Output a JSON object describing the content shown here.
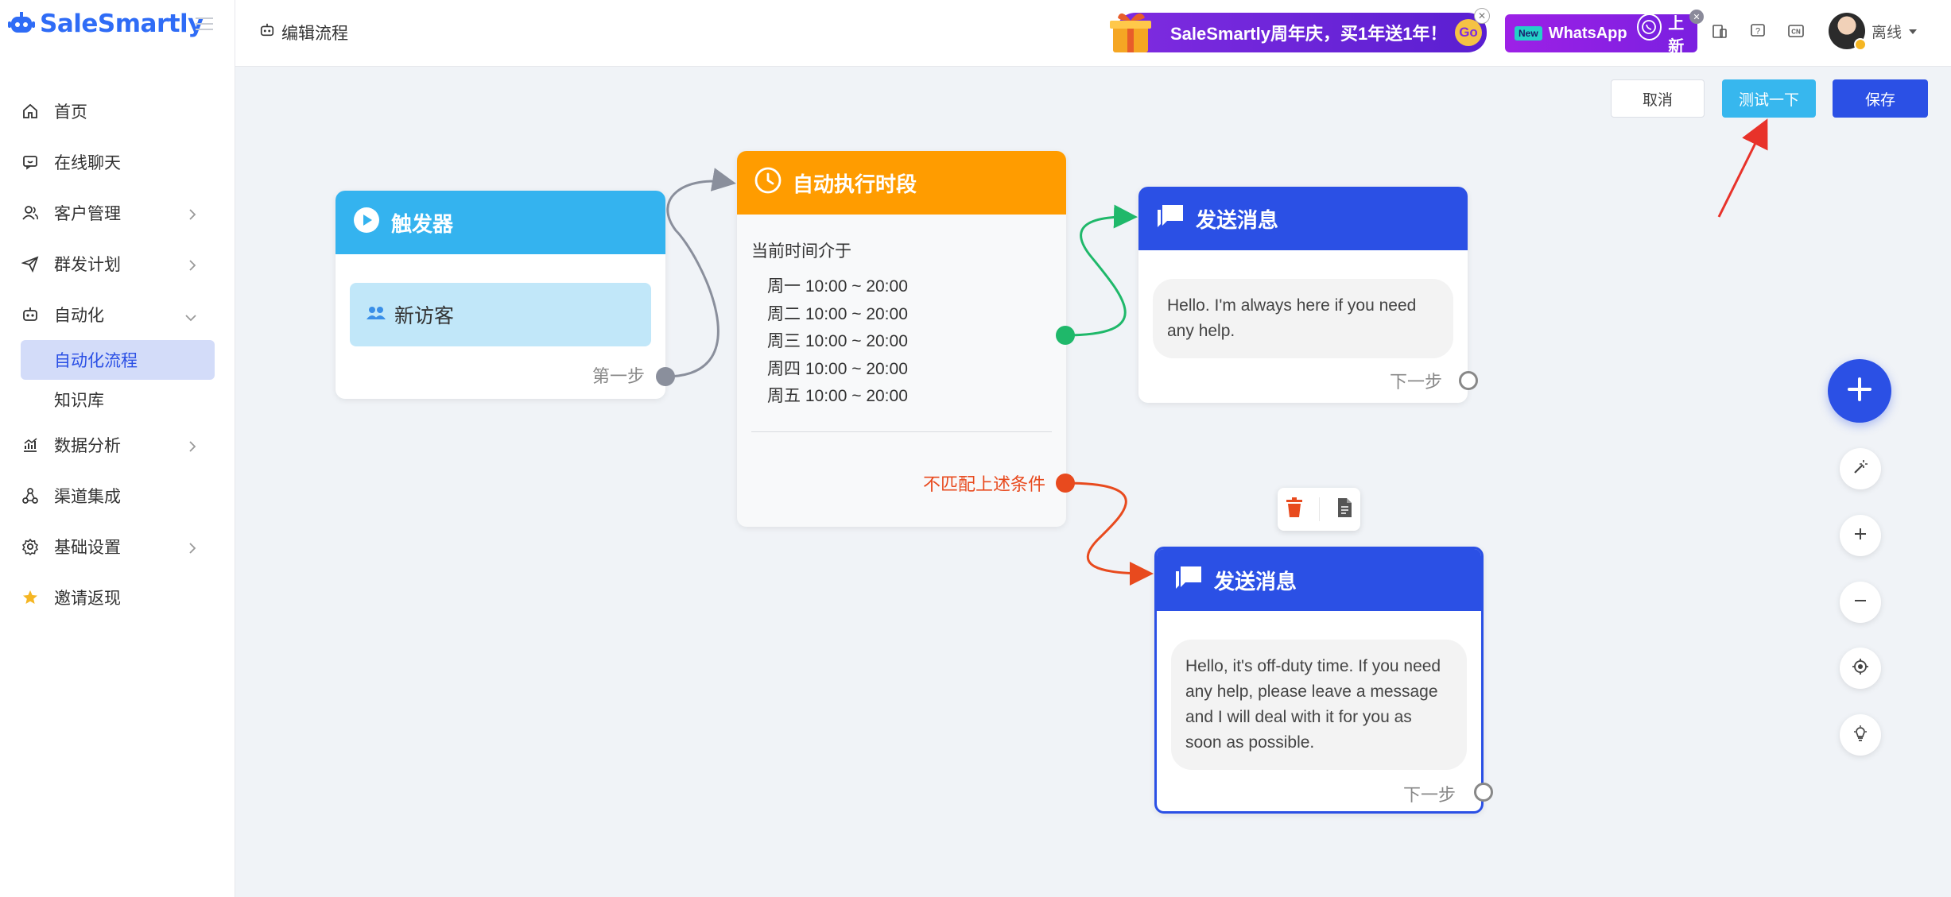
{
  "app": {
    "brand": "SaleSmartly"
  },
  "sidebar": {
    "items": [
      {
        "label": "首页",
        "icon": "home-icon"
      },
      {
        "label": "在线聊天",
        "icon": "chat-icon"
      },
      {
        "label": "客户管理",
        "icon": "users-icon"
      },
      {
        "label": "群发计划",
        "icon": "send-icon"
      },
      {
        "label": "自动化",
        "icon": "robot-icon"
      },
      {
        "label": "数据分析",
        "icon": "chart-icon"
      },
      {
        "label": "渠道集成",
        "icon": "channels-icon"
      },
      {
        "label": "基础设置",
        "icon": "gear-icon"
      },
      {
        "label": "邀请返现",
        "icon": "star-icon"
      }
    ],
    "sub_items": [
      {
        "label": "自动化流程",
        "active": true
      },
      {
        "label": "知识库",
        "active": false
      }
    ]
  },
  "header": {
    "breadcrumb": "编辑流程",
    "promo_text": "SaleSmartly周年庆，买1年送1年！",
    "promo_go": "Go",
    "whatsapp_badge": "New",
    "whatsapp_text": "WhatsApp",
    "whatsapp_suffix": "上新",
    "user_status": "离线",
    "lang_icon_text": "CN"
  },
  "actions": {
    "cancel": "取消",
    "test": "测试一下",
    "save": "保存"
  },
  "nodes": {
    "trigger": {
      "title": "触发器",
      "condition": "新访客",
      "next_label": "第一步"
    },
    "period": {
      "title": "自动执行时段",
      "intro": "当前时间介于",
      "lines": [
        "周一 10:00 ~ 20:00",
        "周二 10:00 ~ 20:00",
        "周三 10:00 ~ 20:00",
        "周四 10:00 ~ 20:00",
        "周五 10:00 ~ 20:00"
      ],
      "nomatch": "不匹配上述条件"
    },
    "message1": {
      "title": "发送消息",
      "text": "Hello. I'm always here if you need any help.",
      "next_label": "下一步"
    },
    "message2": {
      "title": "发送消息",
      "text": "Hello, it's off-duty time. If you need any help, please leave a message and I will deal with it for you as soon as possible.",
      "next_label": "下一步"
    }
  },
  "colors": {
    "primary": "#2b50e5",
    "trigger": "#34b3ef",
    "period": "#ff9c00",
    "match_wire": "#1fb86a",
    "nomatch_wire": "#e84a1e",
    "default_wire": "#8a8f9c"
  }
}
